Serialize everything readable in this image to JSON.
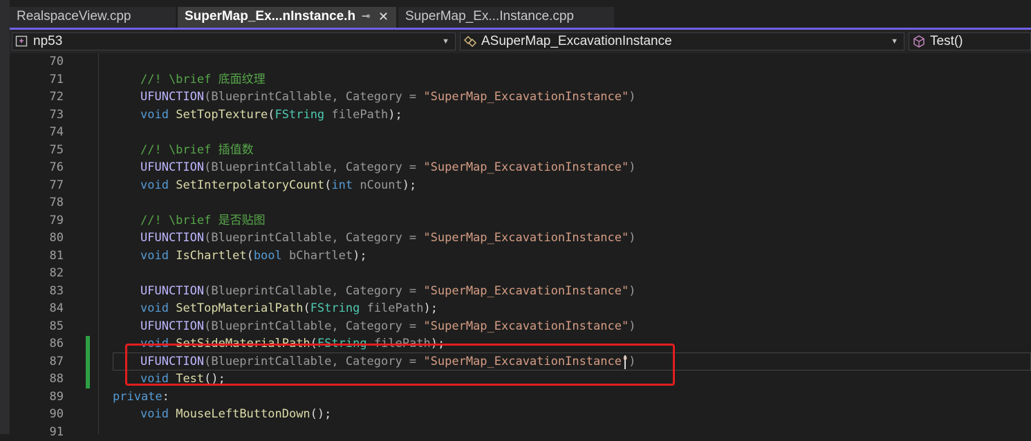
{
  "tabs": [
    {
      "label": "RealspaceView.cpp",
      "active": false
    },
    {
      "label": "SuperMap_Ex...nInstance.h",
      "active": true,
      "pin": "⊸",
      "close": "✕"
    },
    {
      "label": "SuperMap_Ex...Instance.cpp",
      "active": false
    }
  ],
  "nav": {
    "project": "np53",
    "class": "ASuperMap_ExcavationInstance",
    "member": "Test()"
  },
  "icons": {
    "project": "project-icon",
    "class": "class-icon",
    "member": "method-icon",
    "dropdown": "chevron-down-icon"
  },
  "colors": {
    "accent": "#7160e8",
    "highlight_box": "#e31e1e",
    "change_bar": "#2ea043"
  },
  "lines": [
    {
      "n": "70",
      "indent": 0,
      "tokens": []
    },
    {
      "n": "71",
      "indent": 1,
      "tokens": [
        {
          "t": "//! \\brief 底面纹理",
          "c": "cm"
        }
      ]
    },
    {
      "n": "72",
      "indent": 1,
      "tokens": [
        {
          "t": "UFUNCTION",
          "c": "mac"
        },
        {
          "t": "(BlueprintCallable, Category = ",
          "c": "pr"
        },
        {
          "t": "\"SuperMap_ExcavationInstance\"",
          "c": "str"
        },
        {
          "t": ")",
          "c": "pr"
        }
      ]
    },
    {
      "n": "73",
      "indent": 1,
      "tokens": [
        {
          "t": "void",
          "c": "kw"
        },
        {
          "t": " "
        },
        {
          "t": "SetTopTexture",
          "c": "fn"
        },
        {
          "t": "("
        },
        {
          "t": "FString",
          "c": "ty"
        },
        {
          "t": " filePath",
          "c": "pr"
        },
        {
          "t": ");"
        }
      ]
    },
    {
      "n": "74",
      "indent": 0,
      "tokens": []
    },
    {
      "n": "75",
      "indent": 1,
      "tokens": [
        {
          "t": "//! \\brief 插值数",
          "c": "cm"
        }
      ]
    },
    {
      "n": "76",
      "indent": 1,
      "tokens": [
        {
          "t": "UFUNCTION",
          "c": "mac"
        },
        {
          "t": "(BlueprintCallable, Category = ",
          "c": "pr"
        },
        {
          "t": "\"SuperMap_ExcavationInstance\"",
          "c": "str"
        },
        {
          "t": ")",
          "c": "pr"
        }
      ]
    },
    {
      "n": "77",
      "indent": 1,
      "tokens": [
        {
          "t": "void",
          "c": "kw"
        },
        {
          "t": " "
        },
        {
          "t": "SetInterpolatoryCount",
          "c": "fn"
        },
        {
          "t": "("
        },
        {
          "t": "int",
          "c": "kw"
        },
        {
          "t": " nCount",
          "c": "pr"
        },
        {
          "t": ");"
        }
      ]
    },
    {
      "n": "78",
      "indent": 0,
      "tokens": []
    },
    {
      "n": "79",
      "indent": 1,
      "tokens": [
        {
          "t": "//! \\brief 是否贴图",
          "c": "cm"
        }
      ]
    },
    {
      "n": "80",
      "indent": 1,
      "tokens": [
        {
          "t": "UFUNCTION",
          "c": "mac"
        },
        {
          "t": "(BlueprintCallable, Category = ",
          "c": "pr"
        },
        {
          "t": "\"SuperMap_ExcavationInstance\"",
          "c": "str"
        },
        {
          "t": ")",
          "c": "pr"
        }
      ]
    },
    {
      "n": "81",
      "indent": 1,
      "tokens": [
        {
          "t": "void",
          "c": "kw"
        },
        {
          "t": " "
        },
        {
          "t": "IsChartlet",
          "c": "fn"
        },
        {
          "t": "("
        },
        {
          "t": "bool",
          "c": "kw"
        },
        {
          "t": " bChartlet",
          "c": "pr"
        },
        {
          "t": ");"
        }
      ]
    },
    {
      "n": "82",
      "indent": 0,
      "tokens": []
    },
    {
      "n": "83",
      "indent": 1,
      "tokens": [
        {
          "t": "UFUNCTION",
          "c": "mac"
        },
        {
          "t": "(BlueprintCallable, Category = ",
          "c": "pr"
        },
        {
          "t": "\"SuperMap_ExcavationInstance\"",
          "c": "str"
        },
        {
          "t": ")",
          "c": "pr"
        }
      ]
    },
    {
      "n": "84",
      "indent": 1,
      "tokens": [
        {
          "t": "void",
          "c": "kw"
        },
        {
          "t": " "
        },
        {
          "t": "SetTopMaterialPath",
          "c": "fn"
        },
        {
          "t": "("
        },
        {
          "t": "FString",
          "c": "ty"
        },
        {
          "t": " filePath",
          "c": "pr"
        },
        {
          "t": ");"
        }
      ]
    },
    {
      "n": "85",
      "indent": 1,
      "tokens": [
        {
          "t": "UFUNCTION",
          "c": "mac"
        },
        {
          "t": "(BlueprintCallable, Category = ",
          "c": "pr"
        },
        {
          "t": "\"SuperMap_ExcavationInstance\"",
          "c": "str"
        },
        {
          "t": ")",
          "c": "pr"
        }
      ]
    },
    {
      "n": "86",
      "indent": 1,
      "tokens": [
        {
          "t": "void",
          "c": "kw"
        },
        {
          "t": " "
        },
        {
          "t": "SetSideMaterialPath",
          "c": "fn"
        },
        {
          "t": "("
        },
        {
          "t": "FString",
          "c": "ty"
        },
        {
          "t": " filePath",
          "c": "pr"
        },
        {
          "t": ");"
        }
      ]
    },
    {
      "n": "87",
      "indent": 1,
      "tokens": [
        {
          "t": "UFUNCTION",
          "c": "mac"
        },
        {
          "t": "(BlueprintCallable, Category = ",
          "c": "pr"
        },
        {
          "t": "\"SuperMap_ExcavationInstance\"",
          "c": "str"
        },
        {
          "t": ")",
          "c": "pr"
        }
      ]
    },
    {
      "n": "88",
      "indent": 1,
      "tokens": [
        {
          "t": "void",
          "c": "kw"
        },
        {
          "t": " "
        },
        {
          "t": "Test",
          "c": "fn"
        },
        {
          "t": "();"
        }
      ]
    },
    {
      "n": "89",
      "indent": 0,
      "tokens": [
        {
          "t": "private",
          "c": "kw"
        },
        {
          "t": ":"
        }
      ]
    },
    {
      "n": "90",
      "indent": 1,
      "tokens": [
        {
          "t": "void",
          "c": "kw"
        },
        {
          "t": " "
        },
        {
          "t": "MouseLeftButtonDown",
          "c": "fn"
        },
        {
          "t": "();"
        }
      ]
    },
    {
      "n": "91",
      "indent": 0,
      "tokens": []
    }
  ]
}
